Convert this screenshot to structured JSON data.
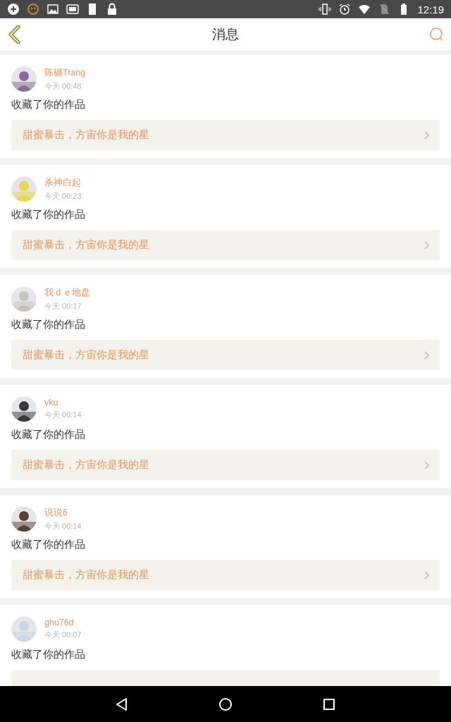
{
  "status_bar": {
    "time": "12:19"
  },
  "header": {
    "title": "消息"
  },
  "messages": [
    {
      "name": "陈樾Trang",
      "time": "今天 00:48",
      "action": "收藏了你的作品",
      "work": "甜蜜暴击，方宙你是我的星"
    },
    {
      "name": "杀神白起",
      "time": "今天 00:23",
      "action": "收藏了你的作品",
      "work": "甜蜜暴击，方宙你是我的星"
    },
    {
      "name": "我ｄｅ地盘",
      "time": "今天 00:17",
      "action": "收藏了你的作品",
      "work": "甜蜜暴击，方宙你是我的星"
    },
    {
      "name": "vku",
      "time": "今天 00:14",
      "action": "收藏了你的作品",
      "work": "甜蜜暴击，方宙你是我的星"
    },
    {
      "name": "说说6",
      "time": "今天 00:14",
      "action": "收藏了你的作品",
      "work": "甜蜜暴击，方宙你是我的星"
    },
    {
      "name": "ghu76d",
      "time": "今天 00:07",
      "action": "收藏了你的作品"
    }
  ]
}
